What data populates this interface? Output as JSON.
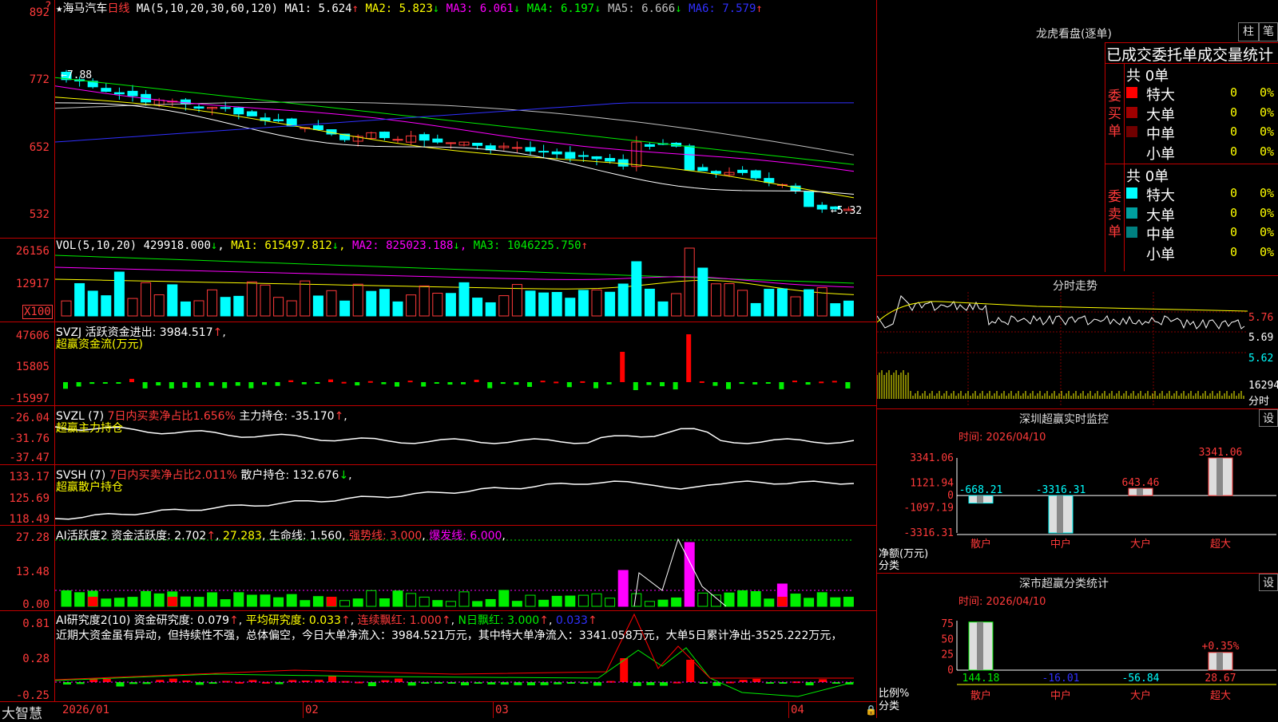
{
  "app": {
    "brand": "大智慧"
  },
  "main_chart": {
    "star": "★",
    "stock_name": "海马汽车",
    "period": "日线",
    "ma_header": "MA(5,10,20,30,60,120)",
    "ma_values": [
      {
        "label": "MA1: 5.624",
        "arrow": "↑",
        "color": "#ffffff"
      },
      {
        "label": "MA2: 5.823",
        "arrow": "↓",
        "color": "#ffff00"
      },
      {
        "label": "MA3: 6.061",
        "arrow": "↓",
        "color": "#ff00ff"
      },
      {
        "label": "MA4: 6.197",
        "arrow": "↓",
        "color": "#00ff00"
      },
      {
        "label": "MA5: 6.666",
        "arrow": "↓",
        "color": "#c0c0c0"
      },
      {
        "label": "MA6: 7.579",
        "arrow": "↑",
        "color": "#3030ff"
      }
    ],
    "y_ticks": [
      "892",
      "772",
      "652",
      "532"
    ],
    "high_label": "7.88",
    "low_label": "5.32"
  },
  "vol_panel": {
    "header": "VOL(5,10,20)",
    "value": "429918.000",
    "value_arrow": "↓",
    "ma1": "MA1: 615497.812",
    "ma1_arrow": "↓",
    "ma2": "MA2: 825023.188",
    "ma2_arrow": "↓",
    "ma3": "MA3: 1046225.750",
    "ma3_arrow": "↑",
    "y_ticks": [
      "26156",
      "12917"
    ],
    "unit": "X100"
  },
  "svzj_panel": {
    "header": "SVZJ  活跃资金进出: 3984.517",
    "arrow": "↑",
    "sub": "超赢资金流(万元)",
    "y_ticks": [
      "47606",
      "15805",
      "-15997"
    ]
  },
  "svzl_panel": {
    "header": "SVZL (7)",
    "pct": "7日内买卖净占比1.656%",
    "hold": "主力持仓: -35.170",
    "arrow": "↑",
    "sub": "超赢主力持仓",
    "y_ticks": [
      "-26.04",
      "-31.76",
      "-37.47"
    ]
  },
  "svsh_panel": {
    "header": "SVSH (7)",
    "pct": "7日内买卖净占比2.011%",
    "hold": "散户持仓: 132.676",
    "arrow": "↓",
    "sub": "超赢散户持仓",
    "y_ticks": [
      "133.17",
      "125.69",
      "118.49"
    ]
  },
  "ai_active_panel": {
    "header": "AI活跃度2 资金活跃度: 2.702",
    "v2": "27.283",
    "life": "生命线: 1.560",
    "strong": "强势线: 3.000",
    "burst": "爆发线: 6.000",
    "y_ticks": [
      "27.28",
      "13.48",
      "0.00"
    ]
  },
  "ai_research_panel": {
    "header": "AI研究度2(10) 资金研究度: 0.079",
    "avg": "平均研究度: 0.033",
    "cont": "连续飘红: 1.000",
    "nday": "N日飘红: 3.000",
    "last": "0.033",
    "comment": "近期大资金虽有异动，但持续性不强，总体偏空，今日大单净流入：3984.521万元，其中特大单净流入：3341.058万元，大单5日累计净出-3525.222万元，",
    "y_ticks": [
      "0.81",
      "0.28",
      "-0.25"
    ]
  },
  "date_axis": [
    "2026/01",
    "02",
    "03",
    "04"
  ],
  "dragon_tiger": {
    "title": "龙虎看盘(逐单)",
    "btn_bar": "柱",
    "btn_pen": "笔",
    "subtitle": "已成交委托单成交量统计",
    "buy_side": "委买单",
    "sell_side": "委卖单",
    "buy_total": "共 0单",
    "sell_total": "共 0单",
    "buy_rows": [
      {
        "name": "特大",
        "color": "#ff0000",
        "count": "0",
        "pct": "0%"
      },
      {
        "name": "大单",
        "color": "#a00000",
        "count": "0",
        "pct": "0%"
      },
      {
        "name": "中单",
        "color": "#700000",
        "count": "0",
        "pct": "0%"
      },
      {
        "name": "小单",
        "color": "#000000",
        "count": "0",
        "pct": "0%"
      }
    ],
    "sell_rows": [
      {
        "name": "特大",
        "color": "#00ffff",
        "count": "0",
        "pct": "0%"
      },
      {
        "name": "大单",
        "color": "#00a0a0",
        "count": "0",
        "pct": "0%"
      },
      {
        "name": "中单",
        "color": "#008080",
        "count": "0",
        "pct": "0%"
      },
      {
        "name": "小单",
        "color": "#000000",
        "count": "0",
        "pct": "0%"
      }
    ]
  },
  "intraday": {
    "title": "分时走势",
    "prices": [
      "5.76",
      "5.69",
      "5.62"
    ],
    "vol": "16294",
    "unit": "分时"
  },
  "sz_monitor": {
    "title": "深圳超赢实时监控",
    "btn": "设",
    "time": "时间: 2026/04/10",
    "y_ticks": [
      "3341.06",
      "1121.94",
      "0",
      "-1097.19",
      "-3316.31"
    ],
    "ylabel": "净额(万元)",
    "xlabel": "分类",
    "chart_data": {
      "type": "bar",
      "categories": [
        "散户",
        "中户",
        "大户",
        "超大"
      ],
      "values": [
        -668.21,
        -3316.31,
        643.46,
        3341.06
      ],
      "value_labels": [
        "-668.21",
        "-3316.31",
        "643.46",
        "3341.06"
      ],
      "ylim": [
        -3316.31,
        3341.06
      ]
    }
  },
  "sz_class": {
    "title": "深市超赢分类统计",
    "btn": "设",
    "time": "时间: 2026/04/10",
    "y_ticks": [
      "75",
      "50",
      "25",
      "0"
    ],
    "ylabel": "比例%",
    "xlabel": "分类",
    "pct_label": "+0.35%",
    "chart_data": {
      "type": "bar",
      "categories": [
        "散户",
        "中户",
        "大户",
        "超大"
      ],
      "values": [
        144.18,
        -16.01,
        -56.84,
        28.67
      ],
      "value_labels": [
        "144.18",
        "-16.01",
        "-56.84",
        "28.67"
      ],
      "ylim": [
        0,
        75
      ]
    }
  },
  "colors": {
    "up": "#ff3a3a",
    "down": "#00ffff",
    "green": "#00ee00",
    "frame": "#c00000"
  }
}
